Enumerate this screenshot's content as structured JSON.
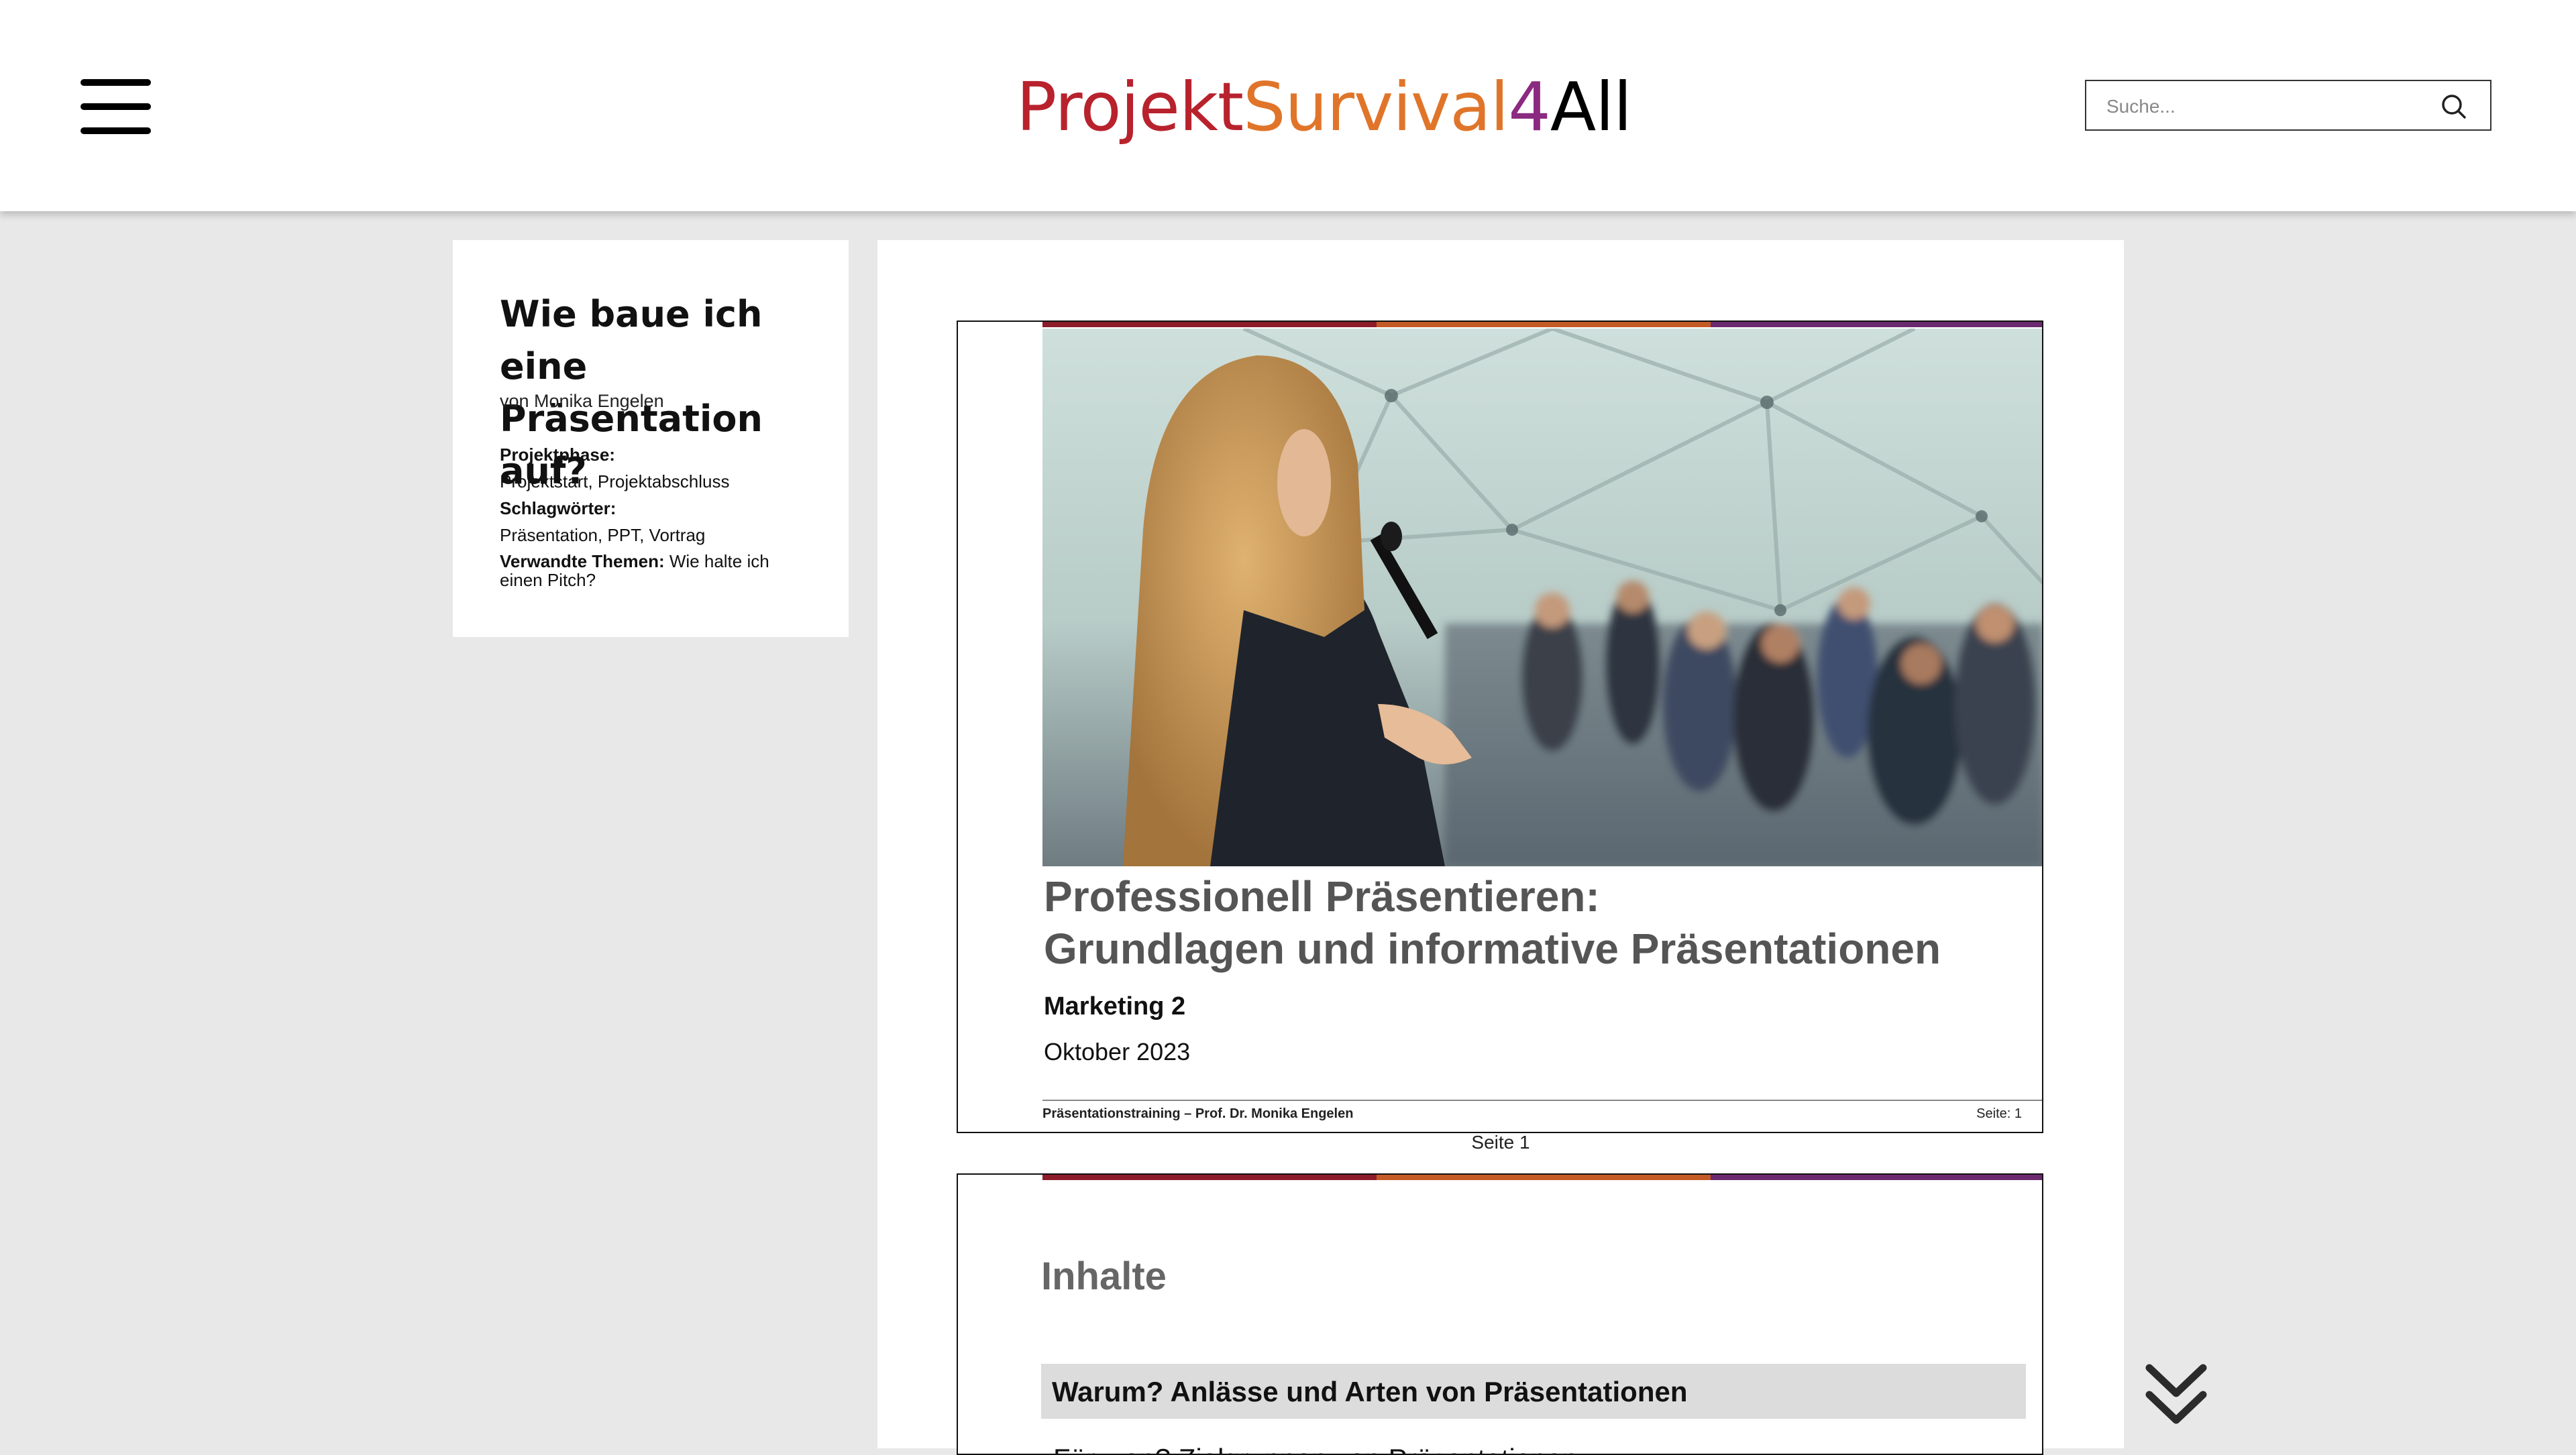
{
  "header": {
    "logo": {
      "part1": "Projekt",
      "part2": "Survival",
      "part3": "4",
      "part4": "All"
    },
    "search": {
      "placeholder": "Suche..."
    }
  },
  "sidebar": {
    "title": "Wie baue ich eine Präsentation auf?",
    "author": "von Monika Engelen",
    "phase_label": "Projektphase:",
    "phase_value": "Projektstart, Projektabschluss",
    "tags_label": "Schlagwörter:",
    "tags_value": "Präsentation, PPT, Vortrag",
    "related_label": "Verwandte Themen:",
    "related_value": "Wie halte ich einen Pitch?"
  },
  "document": {
    "slide1": {
      "title_line1": "Professionell Präsentieren:",
      "title_line2": "Grundlagen und informative Präsentationen",
      "subtitle": "Marketing 2",
      "date": "Oktober 2023",
      "footer_left": "Präsentationstraining – Prof. Dr. Monika Engelen",
      "footer_right": "Seite: 1"
    },
    "page_label": "Seite 1",
    "slide2": {
      "title": "Inhalte",
      "item_highlighted": "Warum? Anlässe und Arten von Präsentationen",
      "item_next": "Für wen? Zielgruppen von Präsentationen"
    }
  },
  "colors": {
    "brand_red": "#b8222d",
    "brand_orange": "#e0752a",
    "brand_purple": "#8a2a80",
    "page_background": "#e8e8e8"
  },
  "icons": [
    "menu-icon",
    "search-icon",
    "double-chevron-down-icon"
  ]
}
